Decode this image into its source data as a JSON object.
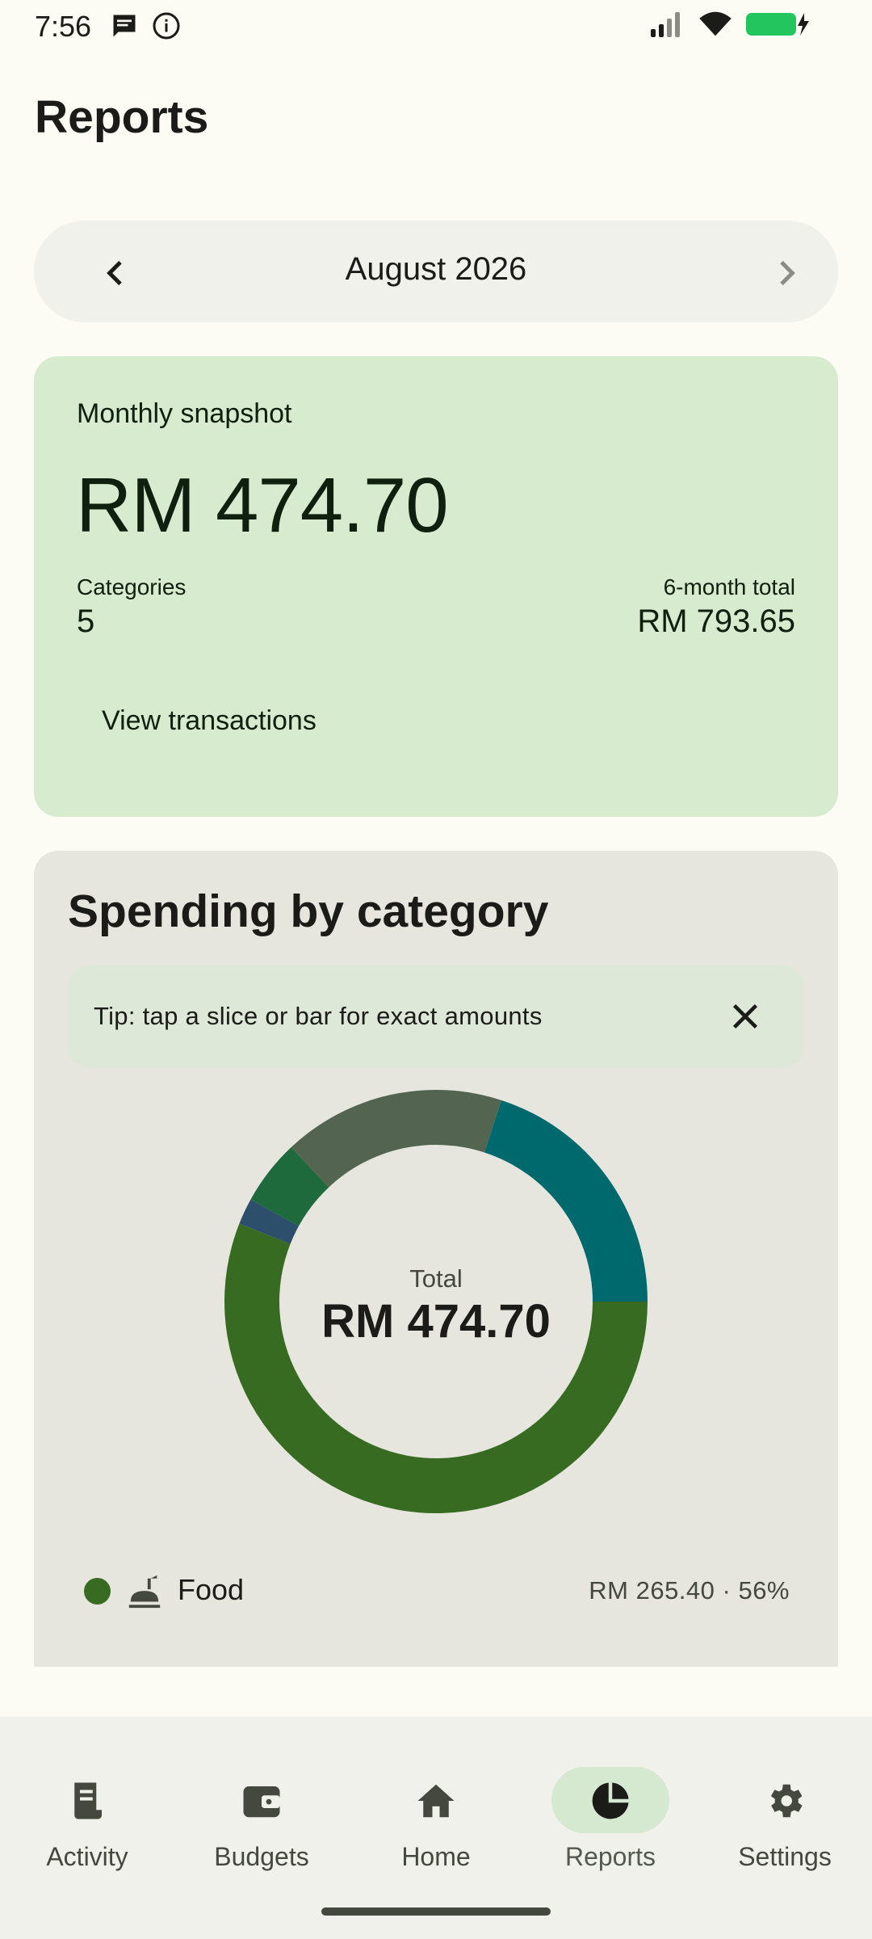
{
  "status_bar": {
    "time": "7:56",
    "icons": [
      "message-icon",
      "info-icon",
      "signal-icon",
      "wifi-icon",
      "battery-charging-icon"
    ]
  },
  "header": {
    "title": "Reports"
  },
  "month_selector": {
    "label": "August 2026",
    "prev_icon": "chevron-left-icon",
    "next_icon": "chevron-right-icon"
  },
  "snapshot": {
    "label": "Monthly snapshot",
    "amount": "RM 474.70",
    "categories_label": "Categories",
    "categories_value": "5",
    "six_month_label": "6-month total",
    "six_month_value": "RM 793.65",
    "view_transactions": "View transactions"
  },
  "spending": {
    "title": "Spending by category",
    "tip": "Tip: tap a slice or bar for exact amounts",
    "center_label": "Total",
    "center_value": "RM 474.70",
    "legend": [
      {
        "name": "Food",
        "value": "RM 265.40 · 56%",
        "icon": "food-icon",
        "color": "#376b21"
      }
    ]
  },
  "chart_data": {
    "type": "pie",
    "style": "donut",
    "total_label": "Total",
    "total_value": "RM 474.70",
    "slices": [
      {
        "label": "Food",
        "share": 0.56,
        "color": "#376b21"
      },
      {
        "label": "",
        "share": 0.02,
        "color": "#2c4f6b"
      },
      {
        "label": "",
        "share": 0.05,
        "color": "#1e6a3c"
      },
      {
        "label": "",
        "share": 0.17,
        "color": "#536550"
      },
      {
        "label": "",
        "share": 0.2,
        "color": "#00696e"
      }
    ]
  },
  "bottom_nav": {
    "items": [
      {
        "label": "Activity",
        "icon": "receipt-icon",
        "active": false
      },
      {
        "label": "Budgets",
        "icon": "wallet-icon",
        "active": false
      },
      {
        "label": "Home",
        "icon": "home-icon",
        "active": false
      },
      {
        "label": "Reports",
        "icon": "pie-chart-icon",
        "active": true
      },
      {
        "label": "Settings",
        "icon": "gear-icon",
        "active": false
      }
    ]
  }
}
